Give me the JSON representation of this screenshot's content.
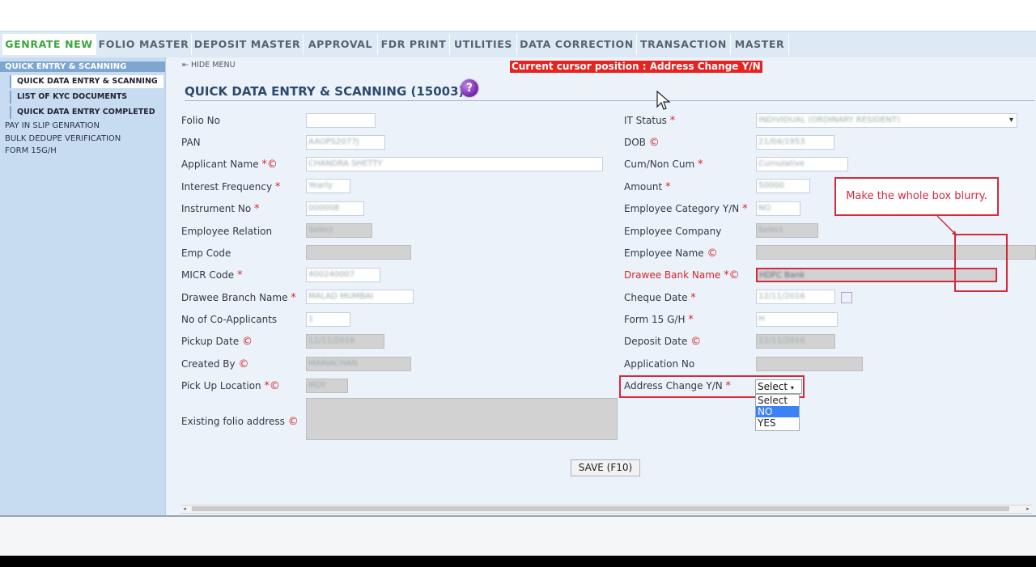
{
  "nav": {
    "tabs": [
      {
        "label": "GENRATE NEW",
        "active": true
      },
      {
        "label": "FOLIO MASTER",
        "active": false
      },
      {
        "label": "DEPOSIT MASTER",
        "active": false
      },
      {
        "label": "APPROVAL",
        "active": false
      },
      {
        "label": "FDR PRINT",
        "active": false
      },
      {
        "label": "UTILITIES",
        "active": false
      },
      {
        "label": "DATA CORRECTION",
        "active": false
      },
      {
        "label": "TRANSACTION",
        "active": false
      },
      {
        "label": "MASTER",
        "active": false
      }
    ]
  },
  "sidebar": {
    "items": [
      "QUICK ENTRY & SCANNING",
      "QUICK DATA ENTRY & SCANNING",
      "LIST OF KYC DOCUMENTS",
      "QUICK DATA ENTRY COMPLETED",
      "PAY IN SLIP GENRATION",
      "BULK DEDUPE VERIFICATION",
      "FORM 15G/H"
    ]
  },
  "main": {
    "hide_menu": "⇤ HIDE MENU",
    "cursor_position": "Current cursor position : Address Change Y/N",
    "title": "QUICK DATA ENTRY & SCANNING (15003)",
    "help_icon": "?"
  },
  "form": {
    "left": [
      {
        "label": "Folio No",
        "value": ""
      },
      {
        "label": "PAN",
        "value": "AAOPS2077J"
      },
      {
        "label": "Applicant Name",
        "value": "CHANDRA SHETTY"
      },
      {
        "label": "Interest Frequency",
        "value": "Yearly"
      },
      {
        "label": "Instrument No",
        "value": "000008"
      },
      {
        "label": "Employee Relation",
        "value": "Select"
      },
      {
        "label": "Emp Code",
        "value": ""
      },
      {
        "label": "MICR Code",
        "value": "400240007"
      },
      {
        "label": "Drawee Branch Name",
        "value": "MALAD MUMBAI"
      },
      {
        "label": "No of Co-Applicants",
        "value": "1"
      },
      {
        "label": "Pickup Date",
        "value": "12/11/2016"
      },
      {
        "label": "Created By",
        "value": "MARIACHAN"
      },
      {
        "label": "Pick Up Location",
        "value": "MDY"
      },
      {
        "label": "Existing folio address",
        "value": ""
      }
    ],
    "right": [
      {
        "label": "IT Status",
        "value": "INDIVIDUAL (ORDINARY RESIDENT)"
      },
      {
        "label": "DOB",
        "value": "21/04/1953"
      },
      {
        "label": "Cum/Non Cum",
        "value": "Cumulative"
      },
      {
        "label": "Amount",
        "value": "50000"
      },
      {
        "label": "Employee Category Y/N",
        "value": "NO"
      },
      {
        "label": "Employee Company",
        "value": "Select"
      },
      {
        "label": "Employee Name",
        "value": ""
      },
      {
        "label": "Drawee Bank Name",
        "value": "HDFC Bank"
      },
      {
        "label": "Cheque Date",
        "value": "12/11/2016"
      },
      {
        "label": "Form 15 G/H",
        "value": "H"
      },
      {
        "label": "Deposit Date",
        "value": "12/11/2016"
      },
      {
        "label": "Application No",
        "value": ""
      },
      {
        "label": "Address Change Y/N",
        "value": "Select"
      }
    ],
    "address_change_options": [
      "Select",
      "NO",
      "YES"
    ],
    "save_label": "SAVE (F10)"
  },
  "annotation": {
    "text": "Make the whole box blurry."
  },
  "colors": {
    "accent": "#d42a3c",
    "active_tab": "#3aa53a",
    "sidebar": "#c8dcf1",
    "content": "#ebf2fa"
  }
}
